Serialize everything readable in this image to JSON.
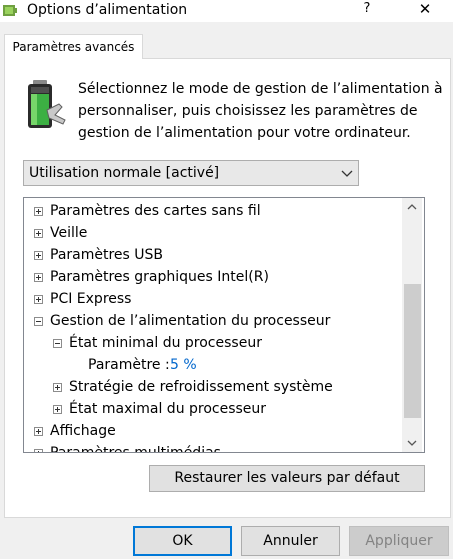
{
  "window": {
    "title": "Options d’alimentation",
    "help_label": "?",
    "close_label": "✕"
  },
  "tab": {
    "label": "Paramètres avancés"
  },
  "description": "Sélectionnez le mode de gestion de l’alimentation à personnaliser, puis choisissez les paramètres de gestion de l’alimentation pour votre ordinateur.",
  "plan_select": {
    "selected": "Utilisation normale [activé]"
  },
  "tree": {
    "items": [
      {
        "label": "Paramètres des cartes sans fil",
        "expander": "plus"
      },
      {
        "label": "Veille",
        "expander": "plus"
      },
      {
        "label": "Paramètres USB",
        "expander": "plus"
      },
      {
        "label": "Paramètres graphiques Intel(R)",
        "expander": "plus"
      },
      {
        "label": "PCI Express",
        "expander": "plus"
      },
      {
        "label": "Gestion de l’alimentation du processeur",
        "expander": "minus"
      },
      {
        "label": "État minimal du processeur",
        "expander": "minus"
      },
      {
        "label": "Paramètre :",
        "value": "5 %"
      },
      {
        "label": "Stratégie de refroidissement système",
        "expander": "plus"
      },
      {
        "label": "État maximal du processeur",
        "expander": "plus"
      },
      {
        "label": "Affichage",
        "expander": "plus"
      },
      {
        "label": "Paramètres multimédias",
        "expander": "plus"
      }
    ]
  },
  "restore_label": "Restaurer les valeurs par défaut",
  "buttons": {
    "ok": "OK",
    "cancel": "Annuler",
    "apply": "Appliquer"
  },
  "colors": {
    "accent": "#0078d7",
    "value_text": "#0066cc",
    "battery_green": "#3cb043"
  }
}
